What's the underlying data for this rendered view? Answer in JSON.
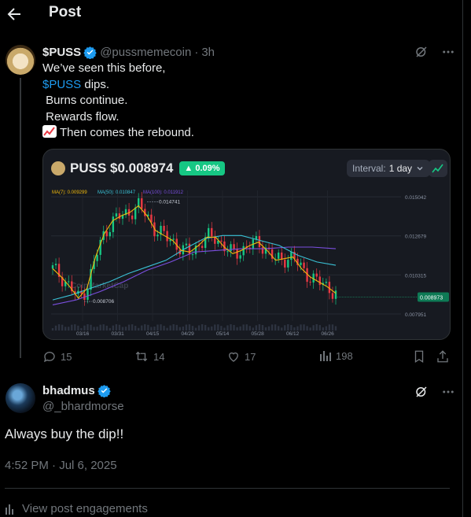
{
  "header": {
    "title": "Post"
  },
  "post": {
    "name": "$PUSS",
    "handle": "@pussmemecoin",
    "separator": "·",
    "time_ago": "3h",
    "lines": [
      "We’ve seen this before,",
      "dips.",
      " Burns continue.",
      " Rewards flow.",
      "Then comes the rebound."
    ],
    "cashtag": "$PUSS",
    "card": {
      "title": "PUSS $0.008974",
      "change": "0.09%",
      "interval_label": "Interval:",
      "interval_value": "1 day",
      "legend": {
        "ma7": "MA(7): 0.009299",
        "ma50": "MA(50): 0.010847",
        "ma100": "MA(100): 0.011912"
      },
      "watermark": "CoinMarketCap",
      "high_label": "0.014741",
      "low_label": "0.008706",
      "current_price_label": "0.008973",
      "colors": {
        "up": "#16c784",
        "down": "#ea3943",
        "ma7": "#f0b90b",
        "ma50": "#3ac2d6",
        "ma100": "#7b4fe0"
      }
    },
    "actions": {
      "replies": "15",
      "reposts": "14",
      "likes": "17",
      "views": "198"
    }
  },
  "reply": {
    "name": "bhadmus",
    "handle": "@_bhardmorse",
    "text": "Always buy the dip!!",
    "timestamp": "4:52 PM · Jul 6, 2025",
    "engagements_label": "View post engagements"
  },
  "chart_data": {
    "type": "line",
    "title": "PUSS $0.008974",
    "x_ticks": [
      "03/16",
      "03/31",
      "04/15",
      "04/29",
      "05/14",
      "05/28",
      "06/12",
      "06/26"
    ],
    "y_ticks": [
      0.015042,
      0.012679,
      0.010315,
      0.007951
    ],
    "ylim": [
      0.00752,
      0.01543
    ],
    "series": [
      {
        "name": "MA(7): 0.009299",
        "values": [
          0.0107,
          0.0102,
          0.0096,
          0.0089,
          0.0095,
          0.0114,
          0.0128,
          0.0136,
          0.0139,
          0.0141,
          0.0145,
          0.0139,
          0.013,
          0.0127,
          0.0124,
          0.0118,
          0.0117,
          0.0121,
          0.0126,
          0.0126,
          0.012,
          0.0116,
          0.0118,
          0.0121,
          0.0123,
          0.0118,
          0.0112,
          0.0113,
          0.0114,
          0.0107,
          0.0102,
          0.0099,
          0.0096,
          0.0092
        ]
      },
      {
        "name": "MA(50): 0.010847",
        "values": [
          0.0088,
          0.0091,
          0.0095,
          0.0099,
          0.0104,
          0.0108,
          0.0112,
          0.0119,
          0.0125,
          0.0127,
          0.0127,
          0.0124,
          0.0121,
          0.0115,
          0.0111,
          0.0109
        ]
      },
      {
        "name": "MA(100): 0.011912",
        "values": [
          0.0085,
          0.0088,
          0.0093,
          0.0099,
          0.0106,
          0.0111,
          0.0117,
          0.0118,
          0.0119,
          0.0119,
          0.012,
          0.012,
          0.0119
        ]
      }
    ],
    "annotations": [
      "0.014741",
      "0.008706",
      "0.008973"
    ]
  }
}
